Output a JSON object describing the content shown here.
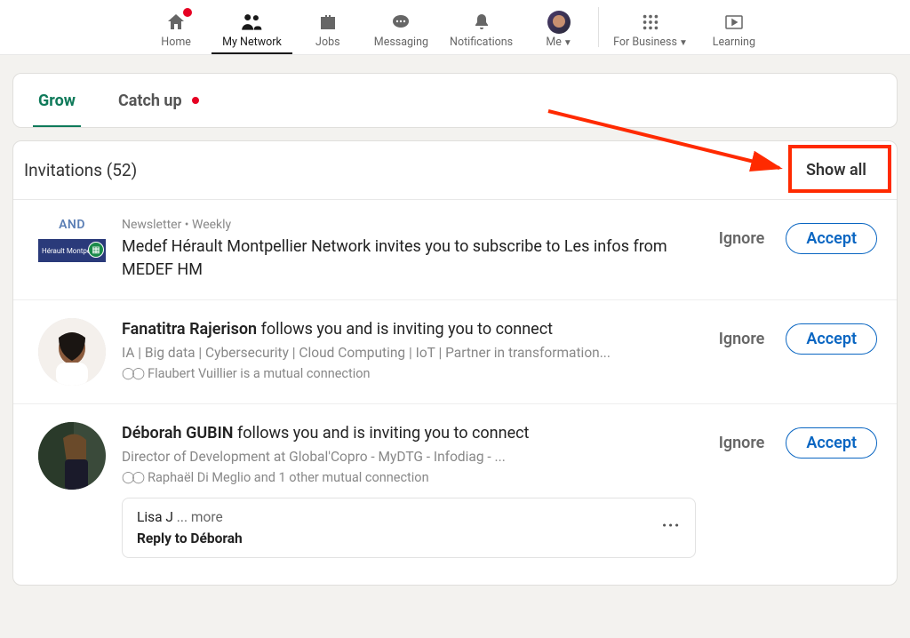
{
  "nav": {
    "home": "Home",
    "network": "My Network",
    "jobs": "Jobs",
    "messaging": "Messaging",
    "notifications": "Notifications",
    "me": "Me",
    "business": "For Business",
    "learning": "Learning"
  },
  "tabs": {
    "grow": "Grow",
    "catchup": "Catch up"
  },
  "invitations": {
    "header": "Invitations (52)",
    "show_all": "Show all",
    "ignore": "Ignore",
    "accept": "Accept"
  },
  "items": [
    {
      "meta": "Newsletter • Weekly",
      "thumb_text": "AND",
      "thumb_strip": "Hérault Montpelli",
      "title_prefix": "Medef Hérault Montpellier Network",
      "title_rest": " invites you to subscribe to Les infos from MEDEF HM"
    },
    {
      "name": "Fanatitra Rajerison",
      "title_rest": " follows you and is inviting you to connect",
      "sub": "IA | Big data | Cybersecurity |  Cloud Computing | IoT | Partner in transformation...",
      "mutual": "Flaubert Vuillier is a mutual connection"
    },
    {
      "name": "Déborah GUBIN",
      "title_rest": " follows you and is inviting you to connect",
      "sub": "Director of Development at Global'Copro - MyDTG - Infodiag                        -  ...",
      "mutual": "Raphaël Di Meglio and 1 other mutual connection",
      "reply_preview_name": "Lisa J",
      "reply_preview_rest": "  ... more",
      "reply_cta": "Reply to Déborah"
    }
  ]
}
